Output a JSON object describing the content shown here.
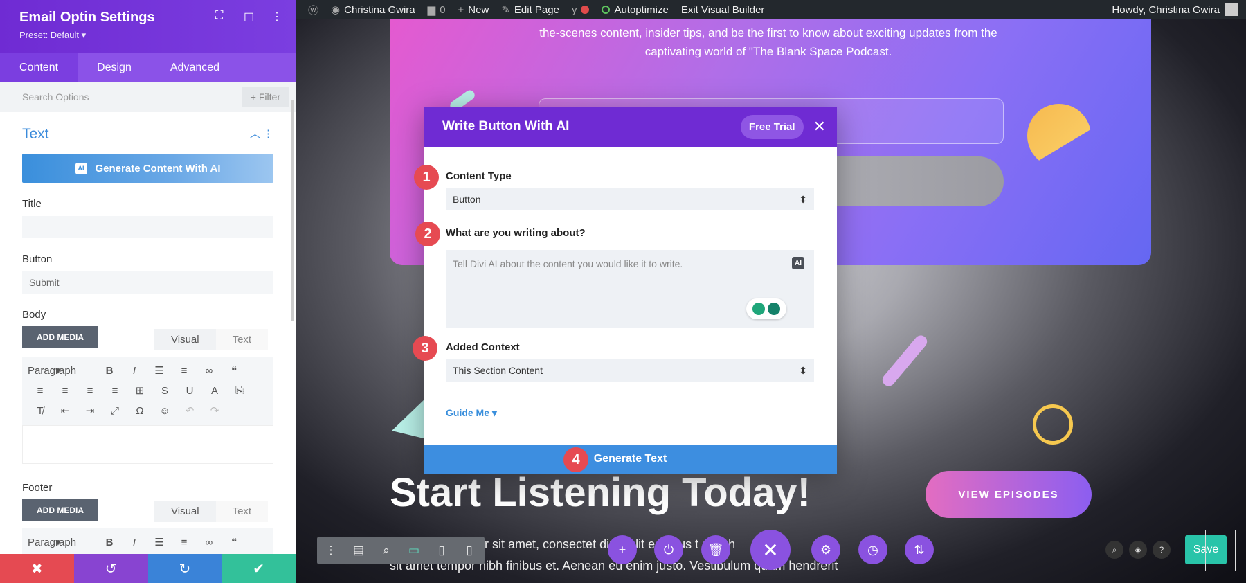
{
  "wp_admin_bar": {
    "site_name": "Christina Gwira",
    "comments_count": "0",
    "new_label": "New",
    "edit_page_label": "Edit Page",
    "autoptimize_label": "Autoptimize",
    "exit_builder_label": "Exit Visual Builder",
    "howdy_label": "Howdy, Christina Gwira"
  },
  "panel": {
    "title": "Email Optin Settings",
    "preset": "Preset: Default ▾",
    "tabs": [
      "Content",
      "Design",
      "Advanced"
    ],
    "search_placeholder": "Search Options",
    "filter_label": "Filter",
    "section_title": "Text",
    "generate_button": "Generate Content With AI",
    "ai_chip": "AI",
    "title_label": "Title",
    "title_value": "",
    "button_label": "Button",
    "button_value": "Submit",
    "body_label": "Body",
    "add_media": "ADD MEDIA",
    "visual_tab": "Visual",
    "text_tab": "Text",
    "paragraph": "Paragraph",
    "footer_label": "Footer"
  },
  "hero": {
    "line1": "the-scenes content, insider tips, and be the first to know about exciting updates from the",
    "line2": "captivating world of \"The Blank Space Podcast."
  },
  "modal": {
    "title": "Write Button With AI",
    "free_trial": "Free Trial",
    "content_type_label": "Content Type",
    "content_type_value": "Button",
    "writing_about_label": "What are you writing about?",
    "prompt_placeholder": "Tell Divi AI about the content you would like it to write.",
    "ai_chip": "AI",
    "added_context_label": "Added Context",
    "added_context_value": "This Section Content",
    "guide_me": "Guide Me",
    "generate_label": "Generate Text",
    "step_badges": [
      "1",
      "2",
      "3",
      "4"
    ]
  },
  "page": {
    "heading": "Start Listening Today!",
    "view_episodes": "VIEW EPISODES",
    "lorem_line1": "or sit amet, consectet   dipis   elit   ecen   us t   s nibh",
    "lorem_line2": "sit amet tempor nibh finibus et. Aenean eu enim justo. Vestibulum   quam hendrerit"
  },
  "builder": {
    "save_label": "Save"
  },
  "colors": {
    "purple_header": "#6f2bd3",
    "blue_accent": "#3a8fdc",
    "badge_red": "#e64a52",
    "save_green": "#29c4a9",
    "panel_cancel": "#e54a52",
    "panel_undo": "#8844d1",
    "panel_redo": "#3a83d8",
    "panel_confirm": "#33c19a"
  }
}
